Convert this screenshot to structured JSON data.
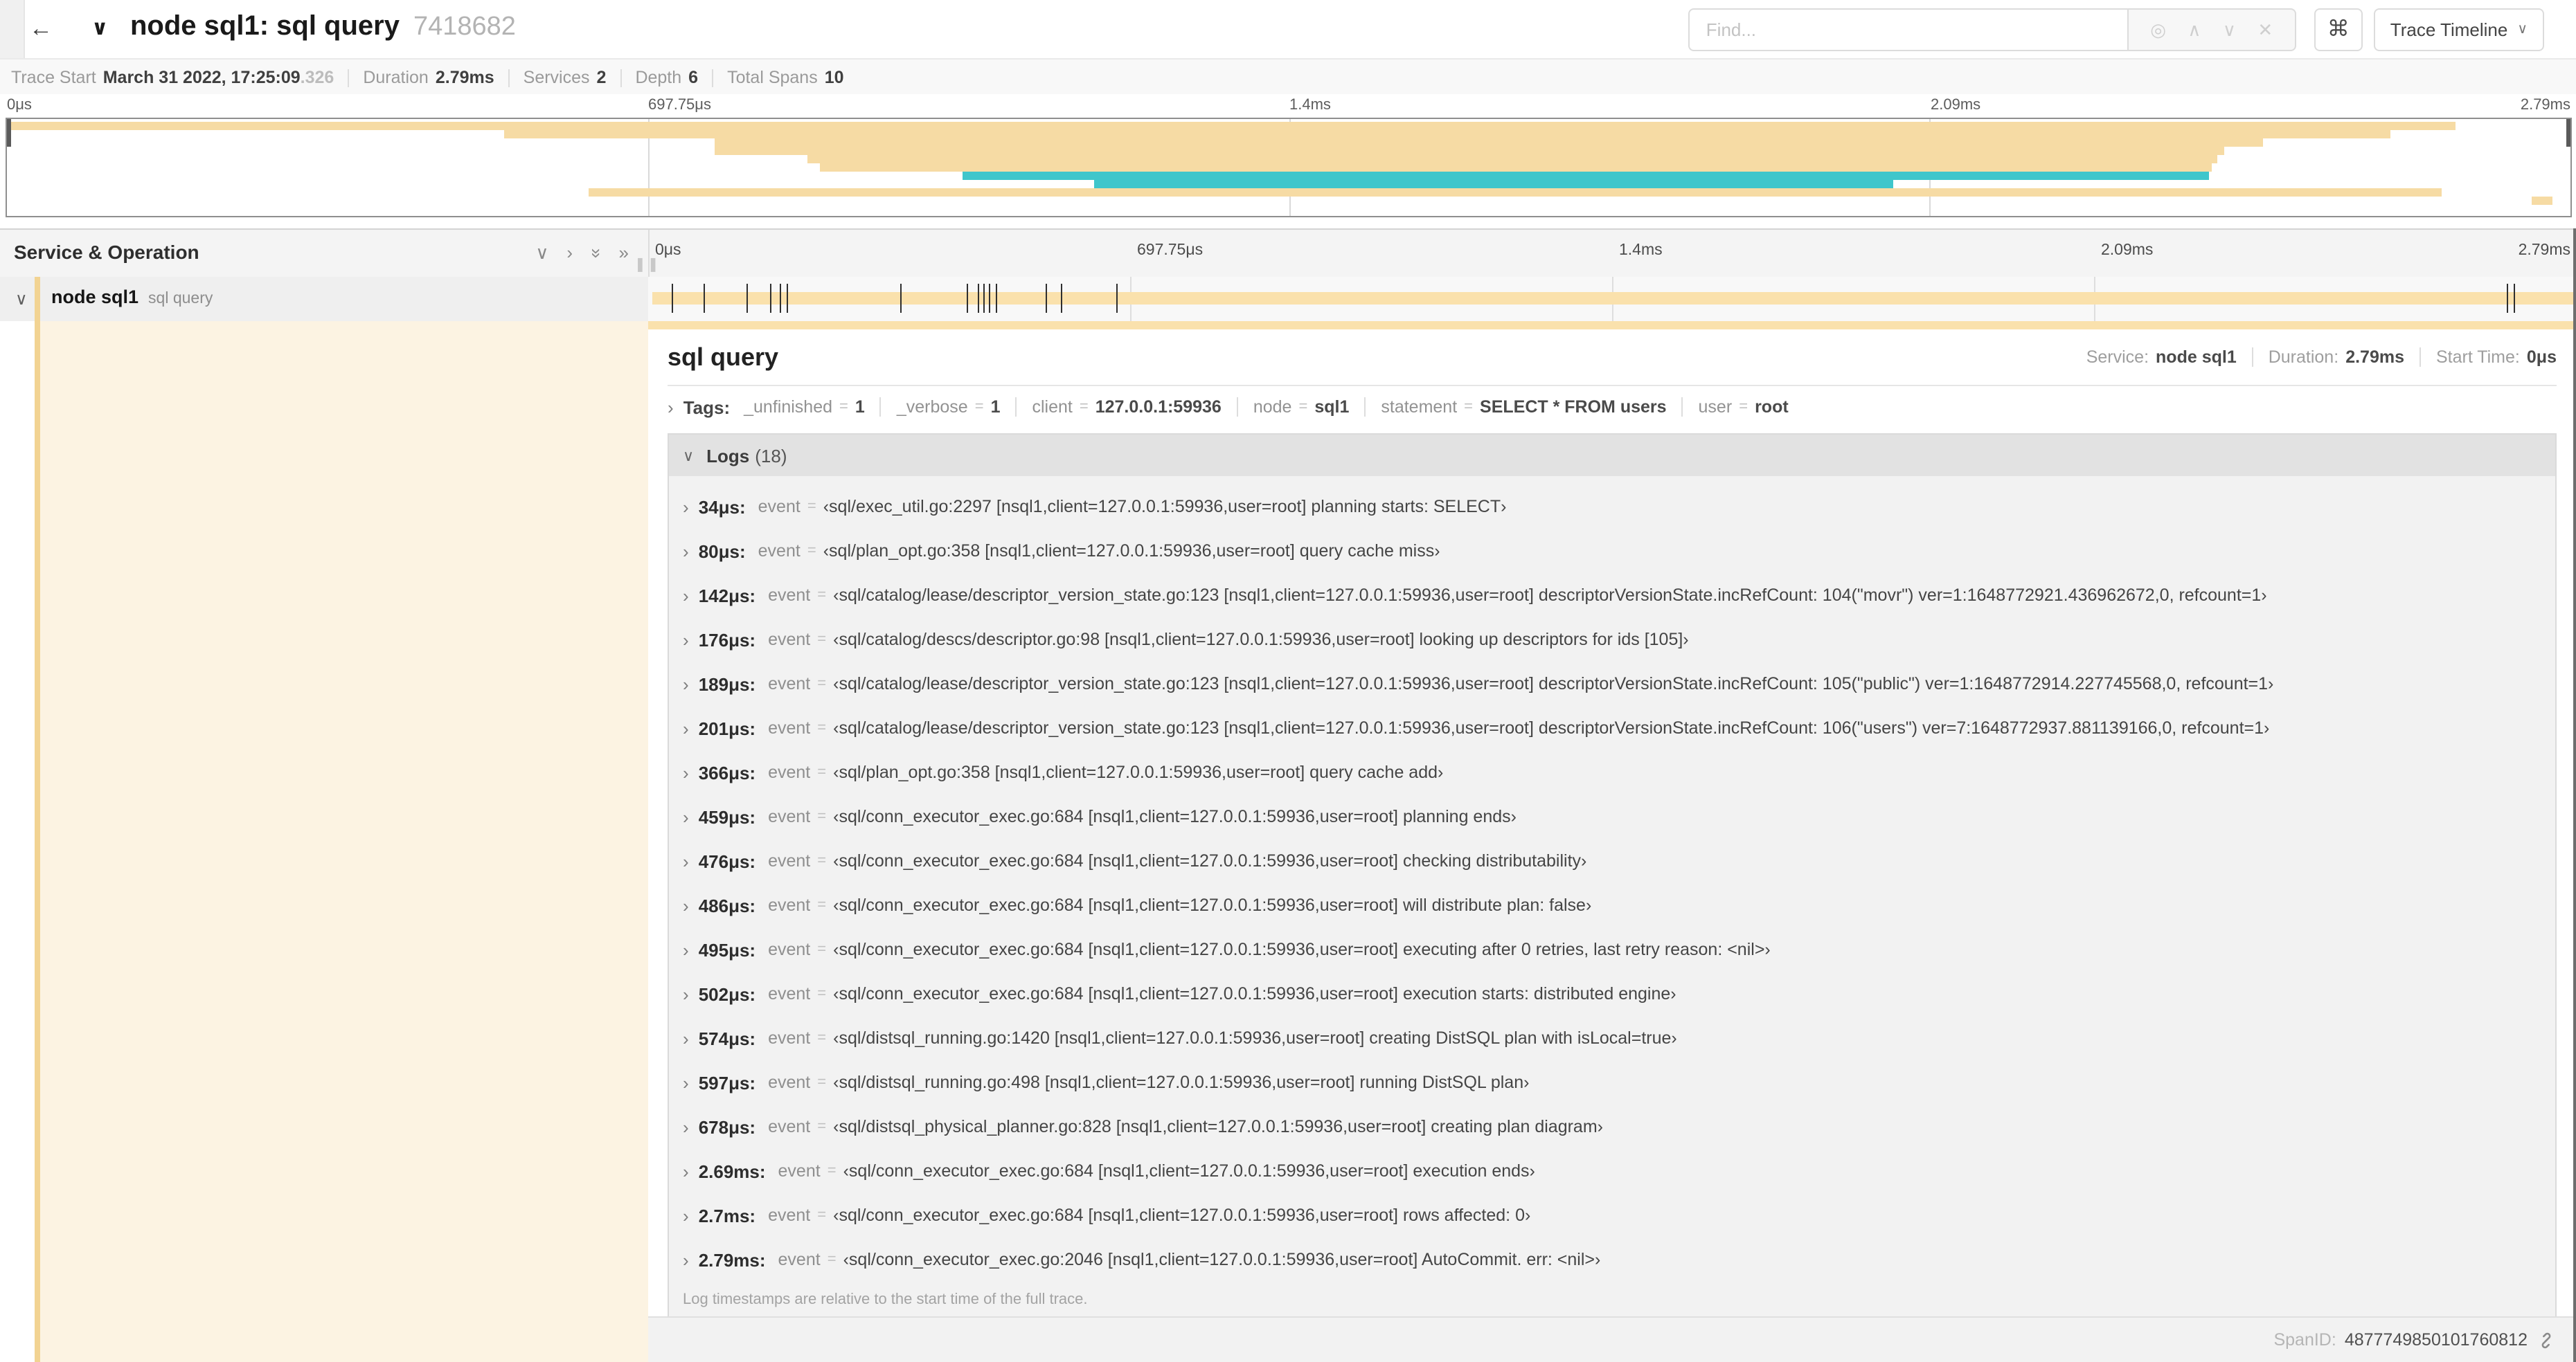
{
  "colors": {
    "span_tan": "#F6DBA4",
    "span_tan_bar": "#FAE1AC",
    "span_teal": "#3FC6CB",
    "accent_strip": "#F2D392",
    "cream_bg": "#FCF3E2"
  },
  "header": {
    "back_icon": "←",
    "title_chevron": "∨",
    "title": "node sql1: sql query",
    "trace_id_short": "7418682",
    "find_placeholder": "Find...",
    "icons": {
      "locate": "◎",
      "prev": "∧",
      "next": "∨",
      "clear": "✕",
      "keyboard": "⌘",
      "caret": "∨"
    },
    "view_button_label": "Trace Timeline"
  },
  "trace_info": {
    "trace_start_label": "Trace Start",
    "trace_start_value": "March 31 2022, 17:25:09",
    "trace_start_fraction": ".326",
    "duration_label": "Duration",
    "duration_value": "2.79ms",
    "services_label": "Services",
    "services_value": "2",
    "depth_label": "Depth",
    "depth_value": "6",
    "total_spans_label": "Total Spans",
    "total_spans_value": "10"
  },
  "minimap": {
    "ticks": [
      {
        "label": "0μs",
        "pos": 0
      },
      {
        "label": "697.75μs",
        "pos": 25
      },
      {
        "label": "1.4ms",
        "pos": 50
      },
      {
        "label": "2.09ms",
        "pos": 75
      },
      {
        "label": "2.79ms",
        "pos": 100
      }
    ],
    "spans": [
      {
        "start": 0,
        "end": 95.5,
        "color": "tan"
      },
      {
        "start": 19.4,
        "end": 93,
        "color": "tan"
      },
      {
        "start": 27.6,
        "end": 88,
        "color": "tan"
      },
      {
        "start": 27.6,
        "end": 86.5,
        "color": "tan"
      },
      {
        "start": 31.2,
        "end": 86.2,
        "color": "tan"
      },
      {
        "start": 31.7,
        "end": 86,
        "color": "tan"
      },
      {
        "start": 37.3,
        "end": 85.9,
        "color": "teal"
      },
      {
        "start": 42.4,
        "end": 73.6,
        "color": "teal"
      },
      {
        "start": 22.7,
        "end": 95,
        "color": "tan"
      },
      {
        "start": 98.5,
        "end": 99.3,
        "color": "tan"
      }
    ]
  },
  "timeline": {
    "column_header": "Service & Operation",
    "collapse_icons": [
      "chevron-down",
      "chevron-right",
      "double-chevron-down",
      "double-chevron-right"
    ],
    "ticks": [
      {
        "label": "0μs",
        "pos": 0
      },
      {
        "label": "697.75μs",
        "pos": 25
      },
      {
        "label": "1.4ms",
        "pos": 50
      },
      {
        "label": "2.09ms",
        "pos": 75
      },
      {
        "label": "2.79ms",
        "pos": 100
      }
    ]
  },
  "span_row": {
    "chevron": "∨",
    "service": "node sql1",
    "operation": "sql query",
    "log_marker_positions": [
      1.2,
      2.9,
      5.1,
      6.3,
      6.8,
      7.2,
      13.1,
      16.5,
      17.1,
      17.4,
      17.7,
      18.0,
      20.6,
      21.4,
      24.3,
      96.4,
      96.8,
      99.85
    ]
  },
  "detail": {
    "title": "sql query",
    "service_label": "Service:",
    "service_value": "node sql1",
    "duration_label": "Duration:",
    "duration_value": "2.79ms",
    "start_time_label": "Start Time:",
    "start_time_value": "0μs",
    "tags_label": "Tags:",
    "tags": [
      {
        "key": "_unfinished",
        "value": "1"
      },
      {
        "key": "_verbose",
        "value": "1"
      },
      {
        "key": "client",
        "value": "127.0.0.1:59936"
      },
      {
        "key": "node",
        "value": "sql1"
      },
      {
        "key": "statement",
        "value": "SELECT * FROM users"
      },
      {
        "key": "user",
        "value": "root"
      }
    ],
    "logs_title": "Logs",
    "logs_count": "(18)",
    "log_field_name": "event",
    "logs": [
      {
        "time": "34μs:",
        "value": "‹sql/exec_util.go:2297 [nsql1,client=127.0.0.1:59936,user=root] planning starts: SELECT›"
      },
      {
        "time": "80μs:",
        "value": "‹sql/plan_opt.go:358 [nsql1,client=127.0.0.1:59936,user=root] query cache miss›"
      },
      {
        "time": "142μs:",
        "value": "‹sql/catalog/lease/descriptor_version_state.go:123 [nsql1,client=127.0.0.1:59936,user=root] descriptorVersionState.incRefCount: 104(\"movr\") ver=1:1648772921.436962672,0, refcount=1›"
      },
      {
        "time": "176μs:",
        "value": "‹sql/catalog/descs/descriptor.go:98 [nsql1,client=127.0.0.1:59936,user=root] looking up descriptors for ids [105]›"
      },
      {
        "time": "189μs:",
        "value": "‹sql/catalog/lease/descriptor_version_state.go:123 [nsql1,client=127.0.0.1:59936,user=root] descriptorVersionState.incRefCount: 105(\"public\") ver=1:1648772914.227745568,0, refcount=1›"
      },
      {
        "time": "201μs:",
        "value": "‹sql/catalog/lease/descriptor_version_state.go:123 [nsql1,client=127.0.0.1:59936,user=root] descriptorVersionState.incRefCount: 106(\"users\") ver=7:1648772937.881139166,0, refcount=1›"
      },
      {
        "time": "366μs:",
        "value": "‹sql/plan_opt.go:358 [nsql1,client=127.0.0.1:59936,user=root] query cache add›"
      },
      {
        "time": "459μs:",
        "value": "‹sql/conn_executor_exec.go:684 [nsql1,client=127.0.0.1:59936,user=root] planning ends›"
      },
      {
        "time": "476μs:",
        "value": "‹sql/conn_executor_exec.go:684 [nsql1,client=127.0.0.1:59936,user=root] checking distributability›"
      },
      {
        "time": "486μs:",
        "value": "‹sql/conn_executor_exec.go:684 [nsql1,client=127.0.0.1:59936,user=root] will distribute plan: false›"
      },
      {
        "time": "495μs:",
        "value": "‹sql/conn_executor_exec.go:684 [nsql1,client=127.0.0.1:59936,user=root] executing after 0 retries, last retry reason: <nil>›"
      },
      {
        "time": "502μs:",
        "value": "‹sql/conn_executor_exec.go:684 [nsql1,client=127.0.0.1:59936,user=root] execution starts: distributed engine›"
      },
      {
        "time": "574μs:",
        "value": "‹sql/distsql_running.go:1420 [nsql1,client=127.0.0.1:59936,user=root] creating DistSQL plan with isLocal=true›"
      },
      {
        "time": "597μs:",
        "value": "‹sql/distsql_running.go:498 [nsql1,client=127.0.0.1:59936,user=root] running DistSQL plan›"
      },
      {
        "time": "678μs:",
        "value": "‹sql/distsql_physical_planner.go:828 [nsql1,client=127.0.0.1:59936,user=root] creating plan diagram›"
      },
      {
        "time": "2.69ms:",
        "value": "‹sql/conn_executor_exec.go:684 [nsql1,client=127.0.0.1:59936,user=root] execution ends›"
      },
      {
        "time": "2.7ms:",
        "value": "‹sql/conn_executor_exec.go:684 [nsql1,client=127.0.0.1:59936,user=root] rows affected: 0›"
      },
      {
        "time": "2.79ms:",
        "value": "‹sql/conn_executor_exec.go:2046 [nsql1,client=127.0.0.1:59936,user=root] AutoCommit. err: <nil>›"
      }
    ],
    "logs_note": "Log timestamps are relative to the start time of the full trace.",
    "span_id_label": "SpanID:",
    "span_id_value": "4877749850101760812"
  }
}
